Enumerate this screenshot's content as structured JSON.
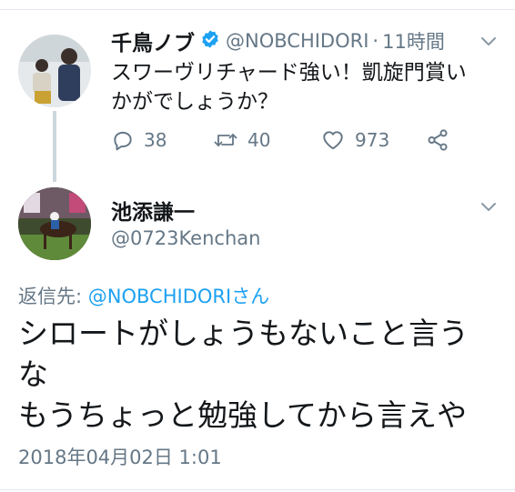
{
  "original_tweet": {
    "name": "千鳥ノブ",
    "verified": true,
    "handle": "@NOBCHIDORI",
    "separator": "·",
    "time": "11時間",
    "text": "スワーヴリチャード強い！凱旋門賞いかがでしょうか？",
    "counts": {
      "replies": "38",
      "retweets": "40",
      "likes": "973"
    },
    "icons": [
      "reply-icon",
      "retweet-icon",
      "like-icon",
      "share-icon",
      "verified-badge-icon",
      "chevron-down-icon"
    ]
  },
  "reply_tweet": {
    "name": "池添謙一",
    "handle": "@0723Kenchan",
    "reply_label": "返信先: ",
    "reply_mention": "@NOBCHIDORI",
    "reply_suffix": "さん",
    "text_lines": [
      "シロートがしょうもないこと言う",
      "な",
      "もうちょっと勉強してから言えや"
    ],
    "timestamp": "2018年04月02日 1:01"
  },
  "colors": {
    "text": "#14171a",
    "secondary": "#657786",
    "link": "#1da1f2",
    "verified": "#1da1f2",
    "divider": "#e1e8ed",
    "thread_line": "#ccd6dd"
  }
}
